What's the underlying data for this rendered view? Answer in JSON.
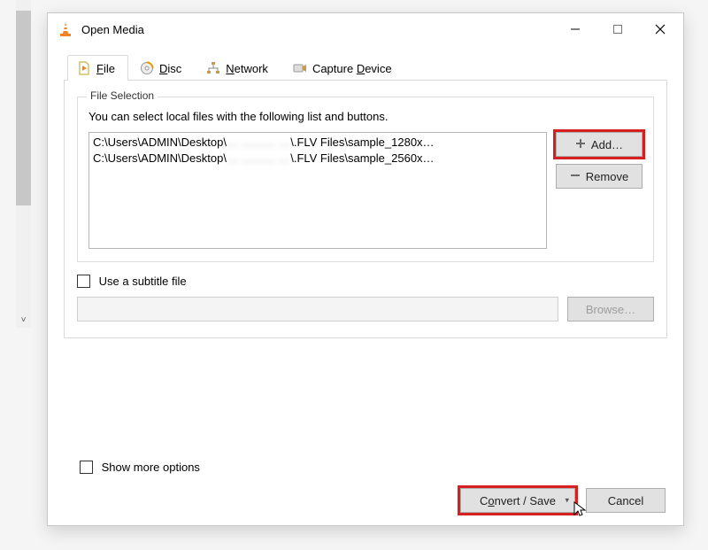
{
  "window": {
    "title": "Open Media"
  },
  "tabs": {
    "file": "File",
    "disc": "Disc",
    "network": "Network",
    "capture": "Capture Device",
    "file_mn": "F",
    "disc_mn": "D",
    "network_mn": "N",
    "capture_mn": "D"
  },
  "file_selection": {
    "legend": "File Selection",
    "help": "You can select local files with the following list and buttons.",
    "items": [
      {
        "pre": "C:\\Users\\ADMIN\\Desktop\\",
        "mid": "… ……… …",
        "post": "\\.FLV Files\\sample_1280x…"
      },
      {
        "pre": "C:\\Users\\ADMIN\\Desktop\\",
        "mid": "… ……… …",
        "post": "\\.FLV Files\\sample_2560x…"
      }
    ],
    "add_label": "Add…",
    "remove_label": "Remove"
  },
  "subtitle": {
    "checkbox_label": "Use a subtitle file",
    "browse_label": "Browse…"
  },
  "more_options": {
    "label_pre": "Show ",
    "label_mn": "m",
    "label_post": "ore options"
  },
  "footer": {
    "convert_pre": "C",
    "convert_mn": "o",
    "convert_post": "nvert / Save",
    "cancel": "Cancel"
  }
}
